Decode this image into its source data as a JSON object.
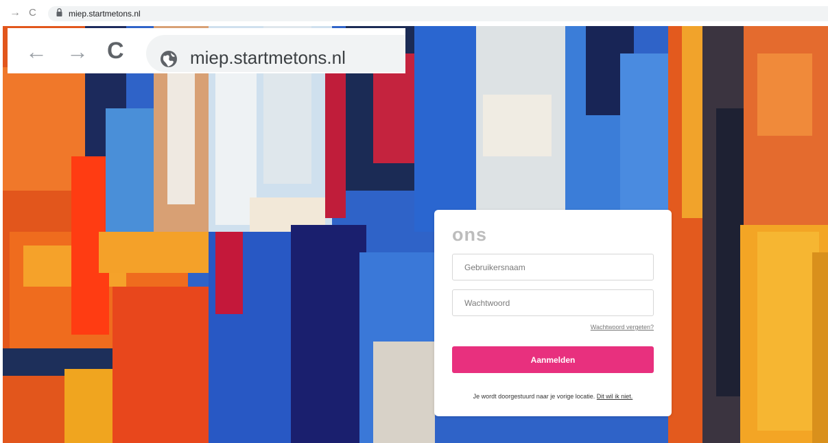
{
  "browser": {
    "url": "miep.startmetons.nl",
    "forward_icon": "→",
    "reload_icon": "C"
  },
  "inset": {
    "back_icon": "←",
    "forward_icon": "→",
    "reload_icon": "C",
    "url": "miep.startmetons.nl"
  },
  "login": {
    "logo": "ons",
    "username_placeholder": "Gebruikersnaam",
    "password_placeholder": "Wachtwoord",
    "forgot_link": "Wachtwoord vergeten?",
    "submit_label": "Aanmelden",
    "redirect_note": "Je wordt doorgestuurd naar je vorige locatie.",
    "redirect_cancel": "Dit wil ik niet."
  },
  "colors": {
    "accent": "#e8307e",
    "logo": "#bdbdbd"
  }
}
